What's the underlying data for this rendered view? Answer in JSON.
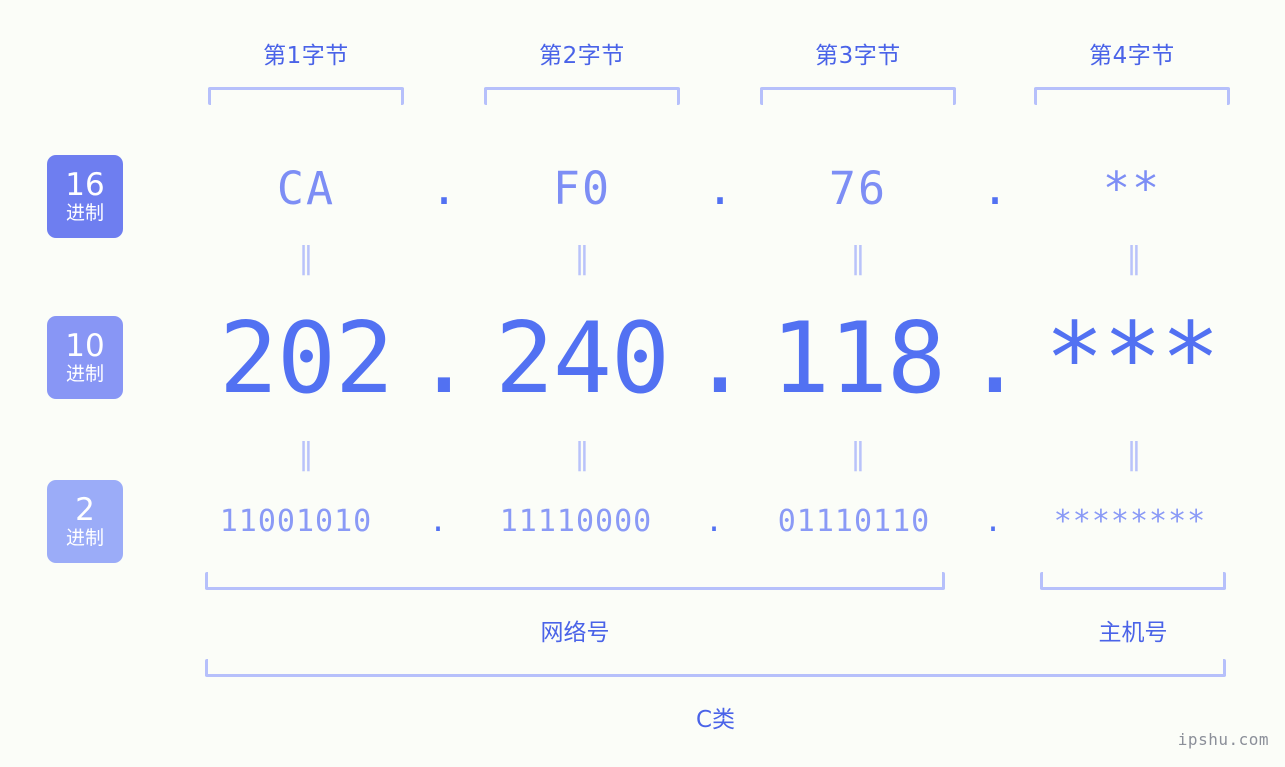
{
  "theme": {
    "background": "#fbfdf8",
    "primary_blue": "#5271f2",
    "light_blue": "#7d8ef5",
    "bracket_blue": "#b6c0fb",
    "label_blue": "#4a63e8",
    "badge_16": "#6e7ef0",
    "badge_10": "#8896f5",
    "badge_2": "#9bacf8"
  },
  "byte_headers": [
    {
      "label": "第1字节"
    },
    {
      "label": "第2字节"
    },
    {
      "label": "第3字节"
    },
    {
      "label": "第4字节"
    }
  ],
  "bases": [
    {
      "number": "16",
      "suffix": "进制"
    },
    {
      "number": "10",
      "suffix": "进制"
    },
    {
      "number": "2",
      "suffix": "进制"
    }
  ],
  "rows": {
    "hex": {
      "values": [
        "CA",
        "F0",
        "76",
        "**"
      ]
    },
    "decimal": {
      "values": [
        "202",
        "240",
        "118",
        "***"
      ]
    },
    "binary": {
      "values": [
        "11001010",
        "11110000",
        "01110110",
        "********"
      ]
    }
  },
  "separator": {
    "dot": "."
  },
  "equals_marker": "‖",
  "sections": {
    "network": "网络号",
    "host": "主机号",
    "class": "C类"
  },
  "watermark": "ipshu.com"
}
